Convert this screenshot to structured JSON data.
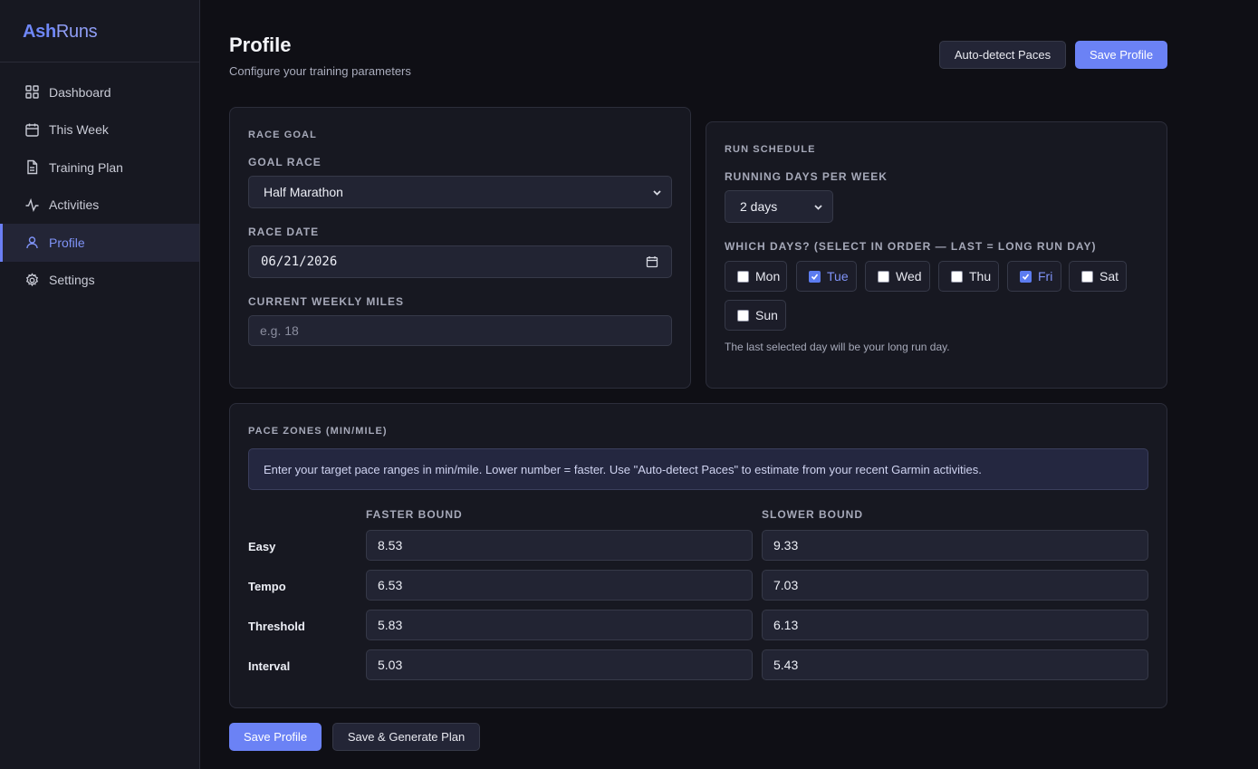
{
  "brand": {
    "part1": "Ash",
    "part2": "Runs"
  },
  "nav": [
    {
      "label": "Dashboard",
      "icon": "grid-icon"
    },
    {
      "label": "This Week",
      "icon": "calendar-icon"
    },
    {
      "label": "Training Plan",
      "icon": "document-icon"
    },
    {
      "label": "Activities",
      "icon": "activity-icon"
    },
    {
      "label": "Profile",
      "icon": "user-icon",
      "active": true
    },
    {
      "label": "Settings",
      "icon": "gear-icon"
    }
  ],
  "header": {
    "title": "Profile",
    "subtitle": "Configure your training parameters",
    "autodetect_label": "Auto-detect Paces",
    "save_label": "Save Profile"
  },
  "race_goal": {
    "section_title": "RACE GOAL",
    "goal_race_label": "GOAL RACE",
    "goal_race_value": "Half Marathon",
    "race_date_label": "RACE DATE",
    "race_date_value": "06/21/2026",
    "weekly_miles_label": "CURRENT WEEKLY MILES",
    "weekly_miles_placeholder": "e.g. 18"
  },
  "run_schedule": {
    "section_title": "RUN SCHEDULE",
    "days_per_week_label": "RUNNING DAYS PER WEEK",
    "days_per_week_value": "2 days",
    "which_days_label": "WHICH DAYS? (SELECT IN ORDER — LAST = LONG RUN DAY)",
    "days": [
      {
        "label": "Mon",
        "checked": false
      },
      {
        "label": "Tue",
        "checked": true
      },
      {
        "label": "Wed",
        "checked": false
      },
      {
        "label": "Thu",
        "checked": false
      },
      {
        "label": "Fri",
        "checked": true
      },
      {
        "label": "Sat",
        "checked": false
      },
      {
        "label": "Sun",
        "checked": false
      }
    ],
    "hint": "The last selected day will be your long run day."
  },
  "pace_zones": {
    "section_title": "PACE ZONES (MIN/MILE)",
    "info": "Enter your target pace ranges in min/mile. Lower number = faster. Use \"Auto-detect Paces\" to estimate from your recent Garmin activities.",
    "faster_label": "FASTER BOUND",
    "slower_label": "SLOWER BOUND",
    "zones": [
      {
        "name": "Easy",
        "faster": "8.53",
        "slower": "9.33"
      },
      {
        "name": "Tempo",
        "faster": "6.53",
        "slower": "7.03"
      },
      {
        "name": "Threshold",
        "faster": "5.83",
        "slower": "6.13"
      },
      {
        "name": "Interval",
        "faster": "5.03",
        "slower": "5.43"
      }
    ]
  },
  "footer": {
    "save_label": "Save Profile",
    "save_generate_label": "Save & Generate Plan"
  },
  "colors": {
    "accent": "#6b82f5",
    "background": "#0f0f15",
    "panel": "#171821"
  }
}
